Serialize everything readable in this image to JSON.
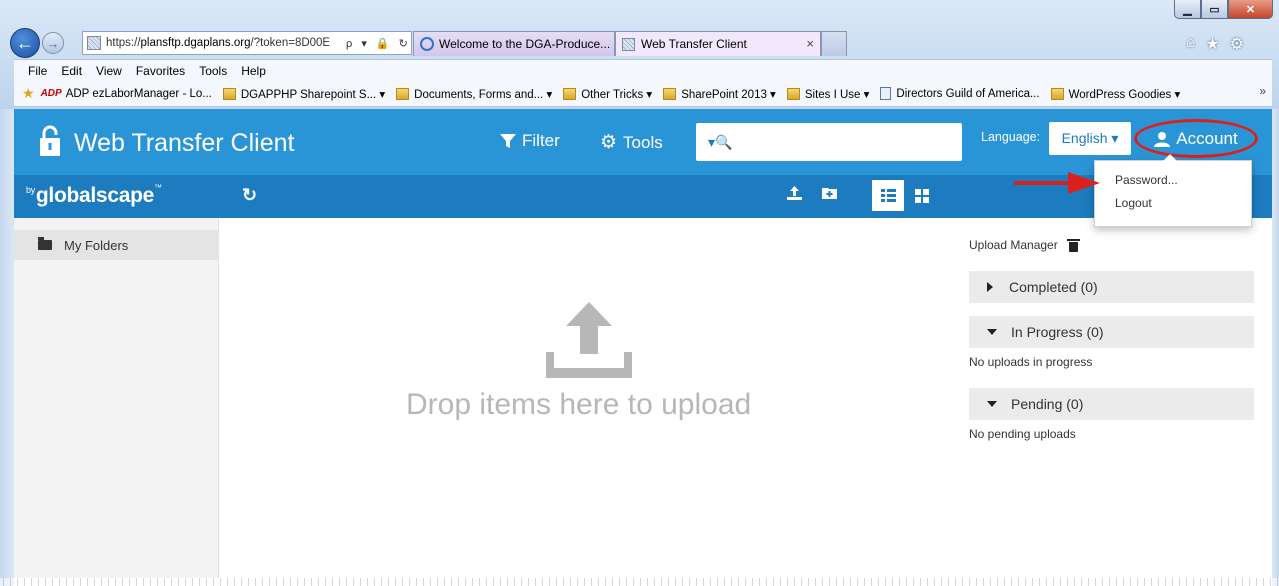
{
  "browser": {
    "address_url_prefix": "https://",
    "address_url_host": "plansftp.dgaplans.org",
    "address_url_rest": "/?token=8D00E",
    "address_tools": "ρ ▾ 🔒 ↻",
    "tabs": [
      {
        "label": "Welcome to the DGA-Produce..."
      },
      {
        "label": "Web Transfer Client"
      }
    ],
    "tab_close": "×",
    "menu": [
      "File",
      "Edit",
      "View",
      "Favorites",
      "Tools",
      "Help"
    ],
    "favorites": [
      {
        "label": "ADP ezLaborManager - Lo..."
      },
      {
        "label": "DGAPPHP Sharepoint S... ▾"
      },
      {
        "label": "Documents, Forms and... ▾"
      },
      {
        "label": "Other Tricks ▾"
      },
      {
        "label": "SharePoint 2013 ▾"
      },
      {
        "label": "Sites I Use ▾"
      },
      {
        "label": "Directors Guild of America..."
      },
      {
        "label": "WordPress Goodies ▾"
      }
    ],
    "adp_mark": "ADP",
    "fav_overflow": "»"
  },
  "app": {
    "title": "Web Transfer Client",
    "filter_label": "Filter",
    "tools_label": "Tools",
    "search_placeholder": "",
    "search_prefix": "▾🔍",
    "language_label": "Language:",
    "language_value": "English ▾",
    "account_label": "Account",
    "brand_prefix": "by",
    "brand_name": "globalscape",
    "brand_tm": "™",
    "account_menu": [
      "Password...",
      "Logout"
    ],
    "accent_color": "#2a95d6",
    "annotation_color": "#d9221e"
  },
  "sidebar": {
    "items": [
      {
        "label": "My Folders"
      }
    ]
  },
  "dropzone": {
    "text": "Drop items here to upload"
  },
  "upload_manager": {
    "title": "Upload Manager",
    "sections": [
      {
        "label": "Completed (0)",
        "expanded": false
      },
      {
        "label": "In Progress (0)",
        "expanded": true,
        "note": "No uploads in progress"
      },
      {
        "label": "Pending (0)",
        "expanded": true,
        "note": "No pending uploads"
      }
    ]
  }
}
